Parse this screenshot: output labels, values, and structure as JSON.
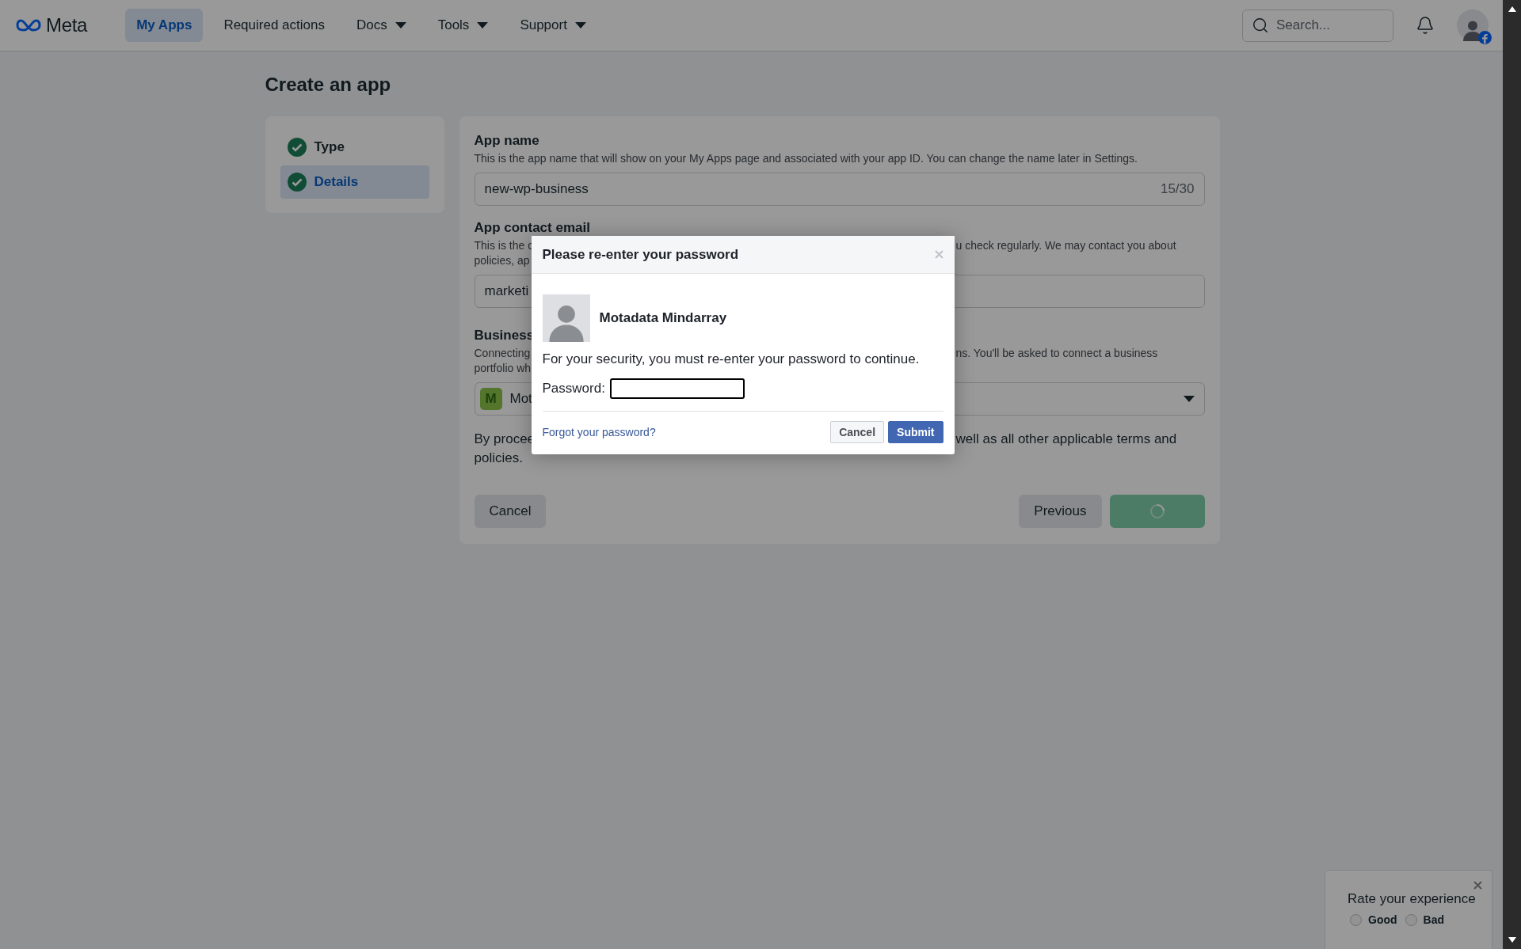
{
  "topbar": {
    "logo": "Meta",
    "nav": [
      {
        "label": "My Apps",
        "selected": true,
        "dropdown": false
      },
      {
        "label": "Required actions",
        "selected": false,
        "dropdown": false
      },
      {
        "label": "Docs",
        "selected": false,
        "dropdown": true
      },
      {
        "label": "Tools",
        "selected": false,
        "dropdown": true
      },
      {
        "label": "Support",
        "selected": false,
        "dropdown": true
      }
    ],
    "search": {
      "placeholder": "Search..."
    }
  },
  "page": {
    "title": "Create an app"
  },
  "steps": [
    {
      "label": "Type",
      "done": true,
      "selected": false
    },
    {
      "label": "Details",
      "done": true,
      "selected": true
    }
  ],
  "form": {
    "app_name": {
      "label": "App name",
      "description": "This is the app name that will show on your My Apps page and associated with your app ID. You can change the name later in Settings.",
      "value": "new-wp-business",
      "counter": "15/30"
    },
    "contact_email": {
      "label": "App contact email",
      "description_lines": [
        {
          "left": "This is the c",
          "right": "u check regularly. We may contact you about"
        },
        {
          "left": "policies, ap"
        }
      ],
      "value": "marketi"
    },
    "business": {
      "label": "Business",
      "description_lines": [
        {
          "left": "Connecting",
          "right": "ns. You'll be asked to connect a business"
        },
        {
          "left": "portfolio wh"
        }
      ],
      "badge": "M",
      "value": "Mot"
    },
    "terms_lines": [
      {
        "left": "By procee",
        "right": "well as all other applicable terms and"
      },
      {
        "left": "policies."
      }
    ],
    "buttons": [
      {
        "kind": "plain",
        "label": "Cancel"
      },
      {
        "kind": "secondary",
        "label": "Previous"
      },
      {
        "kind": "primary",
        "loading": true
      }
    ]
  },
  "dialog": {
    "title": "Please re-enter your password",
    "user": "Motadata Mindarray",
    "message": "For your security, you must re-enter your password to continue.",
    "password_label": "Password:",
    "forgot_link": "Forgot your password?",
    "buttons": [
      {
        "kind": "secondary",
        "label": "Cancel"
      },
      {
        "kind": "primary",
        "label": "Submit"
      }
    ]
  },
  "rating": {
    "title": "Rate your experience",
    "options": [
      {
        "label": "Good",
        "selected": false
      },
      {
        "label": "Bad",
        "selected": false
      }
    ]
  }
}
